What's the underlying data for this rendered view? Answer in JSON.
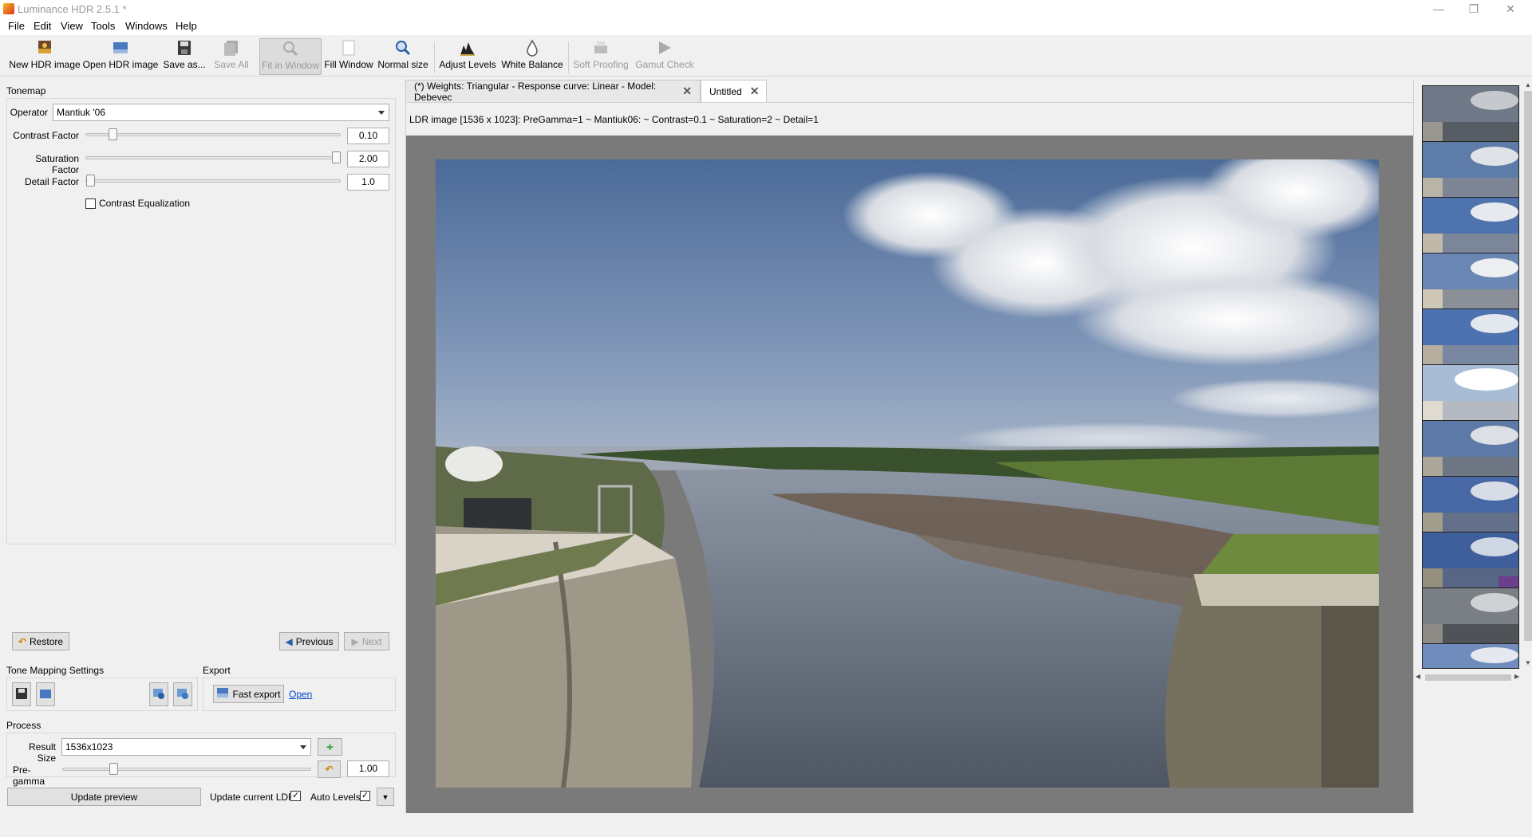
{
  "window": {
    "title": "Luminance HDR 2.5.1 *"
  },
  "menu": [
    "File",
    "Edit",
    "View",
    "Tools",
    "Windows",
    "Help"
  ],
  "toolbar": [
    {
      "label": "New HDR image",
      "icon": "new-hdr-icon",
      "enabled": true
    },
    {
      "label": "Open HDR image",
      "icon": "open-hdr-icon",
      "enabled": true
    },
    {
      "label": "Save as...",
      "icon": "save-as-icon",
      "enabled": true
    },
    {
      "label": "Save All",
      "icon": "save-all-icon",
      "enabled": false
    },
    {
      "label": "Fit in Window",
      "icon": "fit-window-icon",
      "enabled": false,
      "pressed": true
    },
    {
      "label": "Fill Window",
      "icon": "fill-window-icon",
      "enabled": true
    },
    {
      "label": "Normal size",
      "icon": "normal-size-icon",
      "enabled": true
    },
    {
      "label": "Adjust Levels",
      "icon": "adjust-levels-icon",
      "enabled": true
    },
    {
      "label": "White Balance",
      "icon": "white-balance-icon",
      "enabled": true
    },
    {
      "label": "Soft Proofing",
      "icon": "soft-proofing-icon",
      "enabled": false
    },
    {
      "label": "Gamut Check",
      "icon": "gamut-check-icon",
      "enabled": false
    }
  ],
  "tonemap": {
    "group_label": "Tonemap",
    "operator_label": "Operator",
    "operator_value": "Mantiuk '06",
    "contrast_label": "Contrast Factor",
    "contrast_value": "0.10",
    "contrast_level": 0.1,
    "saturation_label": "Saturation Factor",
    "saturation_value": "2.00",
    "saturation_level": 1.0,
    "detail_label": "Detail Factor",
    "detail_value": "1.0",
    "detail_level": 0.0,
    "contrast_eq_label": "Contrast Equalization",
    "restore_label": "Restore",
    "previous_label": "Previous",
    "next_label": "Next"
  },
  "settings": {
    "group_label": "Tone Mapping Settings",
    "export_label": "Export",
    "fast_export_label": "Fast export",
    "open_link": "Open"
  },
  "process": {
    "group_label": "Process",
    "result_size_label": "Result Size",
    "result_size_value": "1536x1023",
    "pregamma_label": "Pre-gamma",
    "pregamma_value": "1.00",
    "pregamma_level": 0.2,
    "update_preview_label": "Update preview",
    "update_ldr_label": "Update current LDR",
    "update_ldr_checked": "✓",
    "auto_levels_label": "Auto Levels",
    "auto_levels_checked": "✓"
  },
  "tabs": [
    {
      "label": "(*) Weights: Triangular - Response curve: Linear - Model: Debevec",
      "active": false
    },
    {
      "label": "Untitled",
      "active": true
    }
  ],
  "info_line": "LDR image [1536 x 1023]: PreGamma=1 ~ Mantiuk06: ~ Contrast=0.1 ~ Saturation=2 ~ Detail=1",
  "preview_count": 11
}
